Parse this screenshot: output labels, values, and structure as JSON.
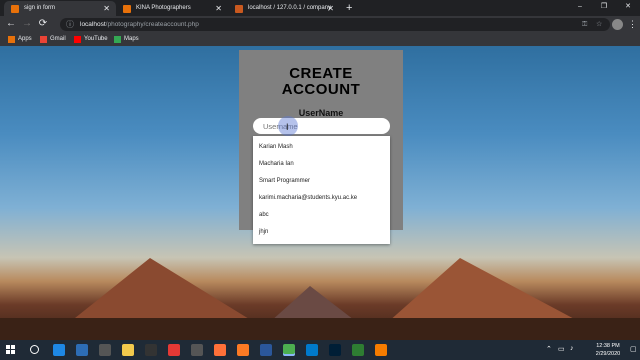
{
  "browser": {
    "tabs": [
      {
        "title": "sign in form",
        "active": true
      },
      {
        "title": "KINA Photographers",
        "active": false
      },
      {
        "title": "localhost / 127.0.0.1 / company",
        "active": false
      }
    ],
    "new_tab_symbol": "+",
    "window_controls": {
      "minimize": "–",
      "maximize": "❐",
      "close": "✕"
    },
    "nav": {
      "back": "←",
      "forward": "→",
      "reload": "⟳"
    },
    "address": {
      "host": "localhost",
      "path": "/photography/createaccount.php",
      "info_symbol": "ⓘ",
      "key_symbol": "⚿",
      "star_symbol": "☆"
    },
    "menu_symbol": "⋮"
  },
  "bookmarks": [
    {
      "label": "Apps",
      "icon": "apps-grid-icon",
      "color": "#e8710a"
    },
    {
      "label": "Gmail",
      "icon": "gmail-icon",
      "color": "#ea4335"
    },
    {
      "label": "YouTube",
      "icon": "youtube-icon",
      "color": "#ff0000"
    },
    {
      "label": "Maps",
      "icon": "maps-icon",
      "color": "#34a853"
    }
  ],
  "form": {
    "title_line1": "CREATE",
    "title_line2": "ACCOUNT",
    "field_label": "UserName",
    "input_placeholder": "Username",
    "autocomplete": [
      "Karian Mash",
      "Macharia Ian",
      "Smart Programmer",
      "karimi.macharia@students.kyu.ac.ke",
      "abc",
      "jhjn"
    ]
  },
  "taskbar": {
    "time": "12:38 PM",
    "date": "2/29/2020",
    "apps": [
      {
        "icon": "search-icon",
        "color": "#1f2a36"
      },
      {
        "icon": "edge-icon",
        "color": "#1e88e5"
      },
      {
        "icon": "mail-icon",
        "color": "#2d6db5"
      },
      {
        "icon": "settings-icon",
        "color": "#555"
      },
      {
        "icon": "file-explorer-icon",
        "color": "#f2c94c"
      },
      {
        "icon": "movies-icon",
        "color": "#333"
      },
      {
        "icon": "opera-icon",
        "color": "#e53935"
      },
      {
        "icon": "media-icon",
        "color": "#555"
      },
      {
        "icon": "firefox-icon",
        "color": "#ff7139"
      },
      {
        "icon": "xampp-icon",
        "color": "#fb7a24"
      },
      {
        "icon": "word-icon",
        "color": "#2b579a"
      },
      {
        "icon": "chrome-icon",
        "color": "#4caf50"
      },
      {
        "icon": "vscode-icon",
        "color": "#007acc"
      },
      {
        "icon": "photoshop-icon",
        "color": "#001e36"
      },
      {
        "icon": "green-app-icon",
        "color": "#2e7d32"
      },
      {
        "icon": "vlc-icon",
        "color": "#f57c00"
      }
    ]
  }
}
